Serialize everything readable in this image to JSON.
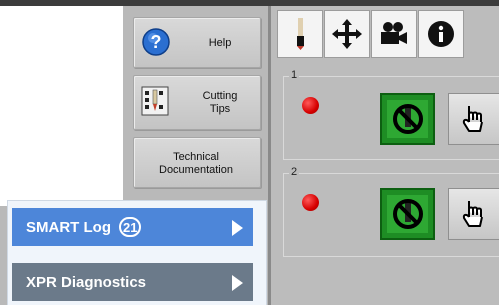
{
  "buttons": {
    "help": "Help",
    "cutting_tips": "Cutting\nTips",
    "technical_documentation": "Technical\nDocumentation"
  },
  "tabs": [
    {
      "icon": "torch-icon"
    },
    {
      "icon": "move-arrows-icon"
    },
    {
      "icon": "camera-icon"
    },
    {
      "icon": "info-icon"
    }
  ],
  "stations": [
    {
      "label": "1",
      "status": "off"
    },
    {
      "label": "2",
      "status": "off"
    }
  ],
  "menu": {
    "smart_log": {
      "label": "SMART Log",
      "count": "21"
    },
    "xpr_diagnostics": {
      "label": "XPR Diagnostics"
    }
  },
  "colors": {
    "smart_log_bg": "#4d86d9",
    "xpr_bg": "#6b7a8a",
    "led_red": "#e00000",
    "stop_green": "#2ea833"
  }
}
